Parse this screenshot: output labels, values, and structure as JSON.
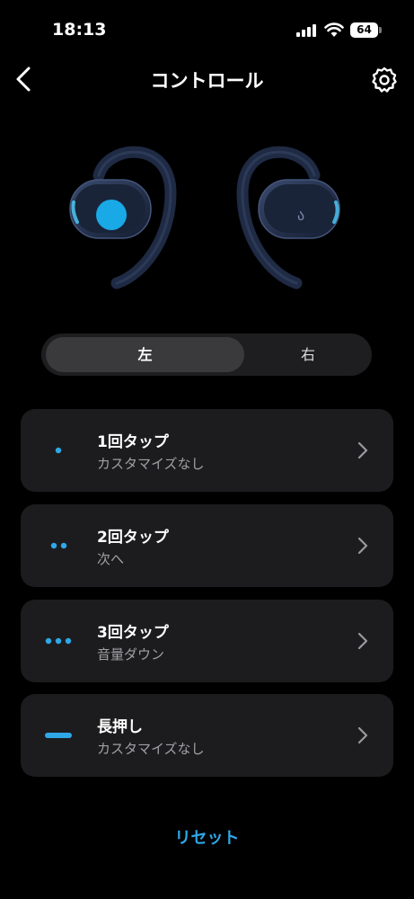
{
  "status": {
    "time": "18:13",
    "battery": "64"
  },
  "nav": {
    "title": "コントロール"
  },
  "tabs": {
    "left": "左",
    "right": "右"
  },
  "controls": [
    {
      "title": "1回タップ",
      "action": "カスタマイズなし",
      "icon": "single-dot-icon"
    },
    {
      "title": "2回タップ",
      "action": "次へ",
      "icon": "double-dot-icon"
    },
    {
      "title": "3回タップ",
      "action": "音量ダウン",
      "icon": "triple-dot-icon"
    },
    {
      "title": "長押し",
      "action": "カスタマイズなし",
      "icon": "long-press-bar-icon"
    }
  ],
  "reset_label": "リセット",
  "colors": {
    "accent": "#2fa8e8",
    "card": "#1c1c1e",
    "background": "#000000"
  }
}
